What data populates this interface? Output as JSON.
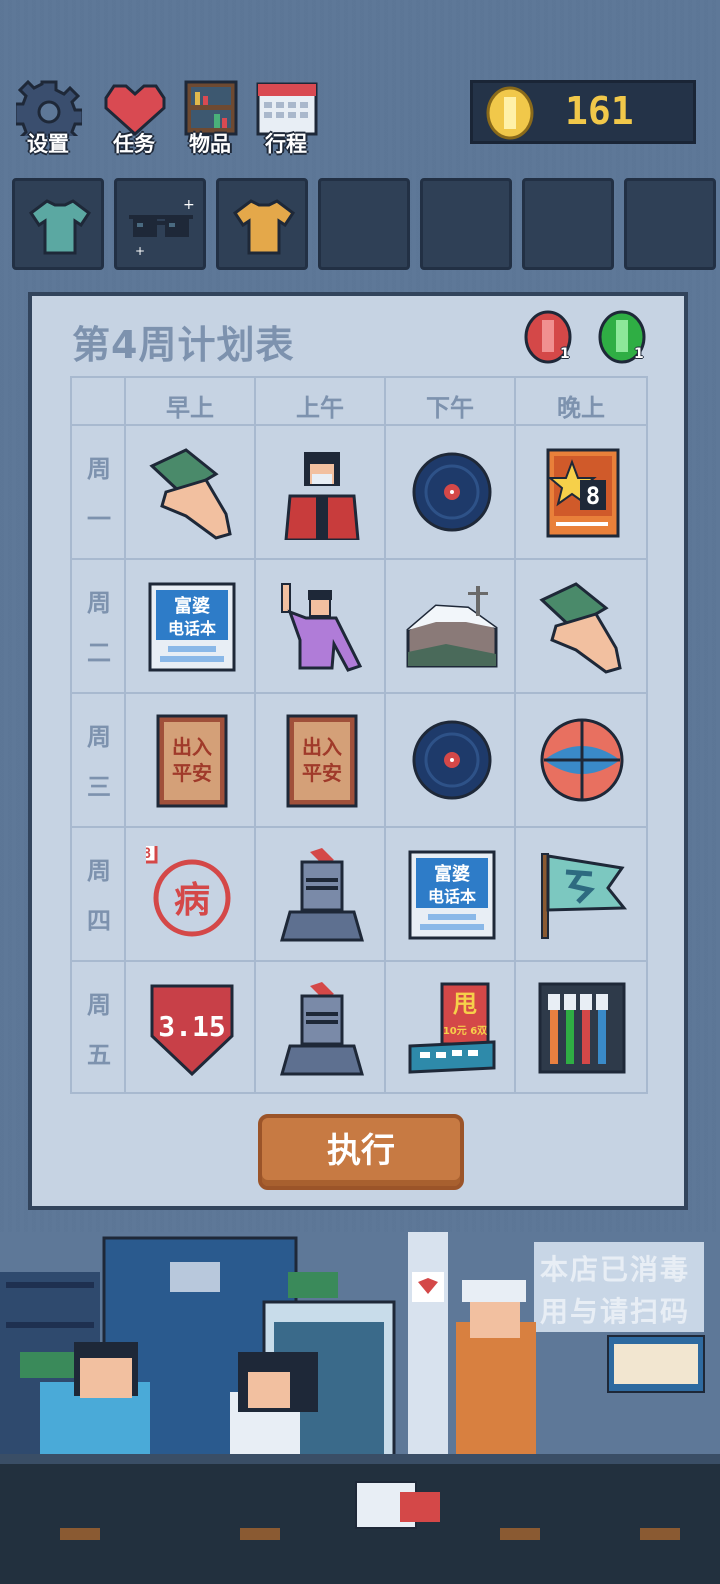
{
  "menu": [
    {
      "label": "设置",
      "icon": "gear-icon"
    },
    {
      "label": "任务",
      "icon": "heart-icon"
    },
    {
      "label": "物品",
      "icon": "shelf-icon"
    },
    {
      "label": "行程",
      "icon": "calendar-icon"
    }
  ],
  "coins": {
    "value": "161",
    "icon": "coin-icon",
    "color": "#f1c84a"
  },
  "inventory": [
    {
      "icon": "teal-tshirt-icon"
    },
    {
      "icon": "sunglasses-icon"
    },
    {
      "icon": "yellow-tshirt-icon"
    },
    {
      "icon": ""
    },
    {
      "icon": ""
    },
    {
      "icon": ""
    },
    {
      "icon": ""
    }
  ],
  "planner": {
    "title": "第4周计划表",
    "tokens": [
      {
        "icon": "red-token-icon",
        "count": "1",
        "color": "#d44848"
      },
      {
        "icon": "green-token-icon",
        "count": "1",
        "color": "#2fae44"
      }
    ],
    "columns": [
      "早上",
      "上午",
      "下午",
      "晚上"
    ],
    "rows": [
      {
        "day": [
          "周",
          "一"
        ],
        "items": [
          "hand-card-icon",
          "red-robot-icon",
          "vinyl-record-icon",
          "star-card-icon"
        ]
      },
      {
        "day": [
          "周",
          "二"
        ],
        "items": [
          "phonebook-icon",
          "waving-person-icon",
          "snowy-house-icon",
          "hand-card-icon"
        ]
      },
      {
        "day": [
          "周",
          "三"
        ],
        "items": [
          "amulet-icon",
          "amulet-icon",
          "vinyl-record-icon",
          "basketball-icon"
        ]
      },
      {
        "day": [
          "周",
          "四"
        ],
        "items": [
          "sick-stamp-icon",
          "knight-helmet-icon",
          "phonebook-icon",
          "flag-icon"
        ]
      },
      {
        "day": [
          "周",
          "五"
        ],
        "items": [
          "shield-315-icon",
          "knight-helmet-icon",
          "shop-sign-icon",
          "toothbrush-box-icon"
        ]
      }
    ],
    "phonebook_text": [
      "富婆",
      "电话本"
    ],
    "amulet_text": [
      "出入",
      "平安"
    ],
    "sick_text": "病",
    "sick_badge": "8",
    "star_card_number": "8",
    "shield_text": "3.15",
    "shop_sign_text": "甩",
    "shop_sign_sub": "10元 6双",
    "execute_label": "执行"
  },
  "scene": {
    "sign": [
      "本店已消毒",
      "用与请扫码"
    ]
  }
}
